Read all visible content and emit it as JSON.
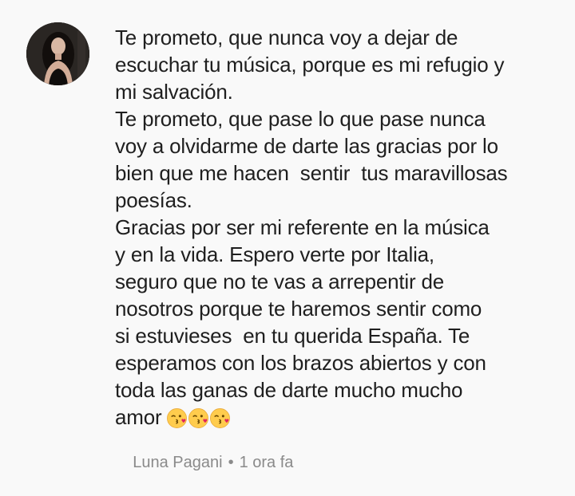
{
  "comment": {
    "lines": [
      "Te prometo, que nunca voy a dejar de",
      "escuchar tu música, porque es mi refugio y",
      "mi salvación.",
      "Te prometo, que pase lo que pase nunca",
      "voy a olvidarme de darte las gracias por lo",
      "bien que me hacen  sentir  tus maravillosas",
      "poesías.",
      "Gracias por ser mi referente en la música",
      "y en la vida. Espero verte por Italia,",
      "seguro que no te vas a arrepentir de",
      "nosotros porque te haremos sentir como",
      "si estuvieses  en tu querida España. Te",
      "esperamos con los brazos abiertos y con",
      "toda las ganas de darte mucho mucho",
      "amor"
    ],
    "emojis": [
      "kissing-face-emoji",
      "kissing-face-emoji",
      "kissing-face-emoji"
    ],
    "author": "Luna Pagani",
    "separator": "•",
    "time": "1 ora fa"
  },
  "colors": {
    "background": "#f9f9f9",
    "text": "#1f1f1f",
    "meta": "#8a8a8a"
  }
}
